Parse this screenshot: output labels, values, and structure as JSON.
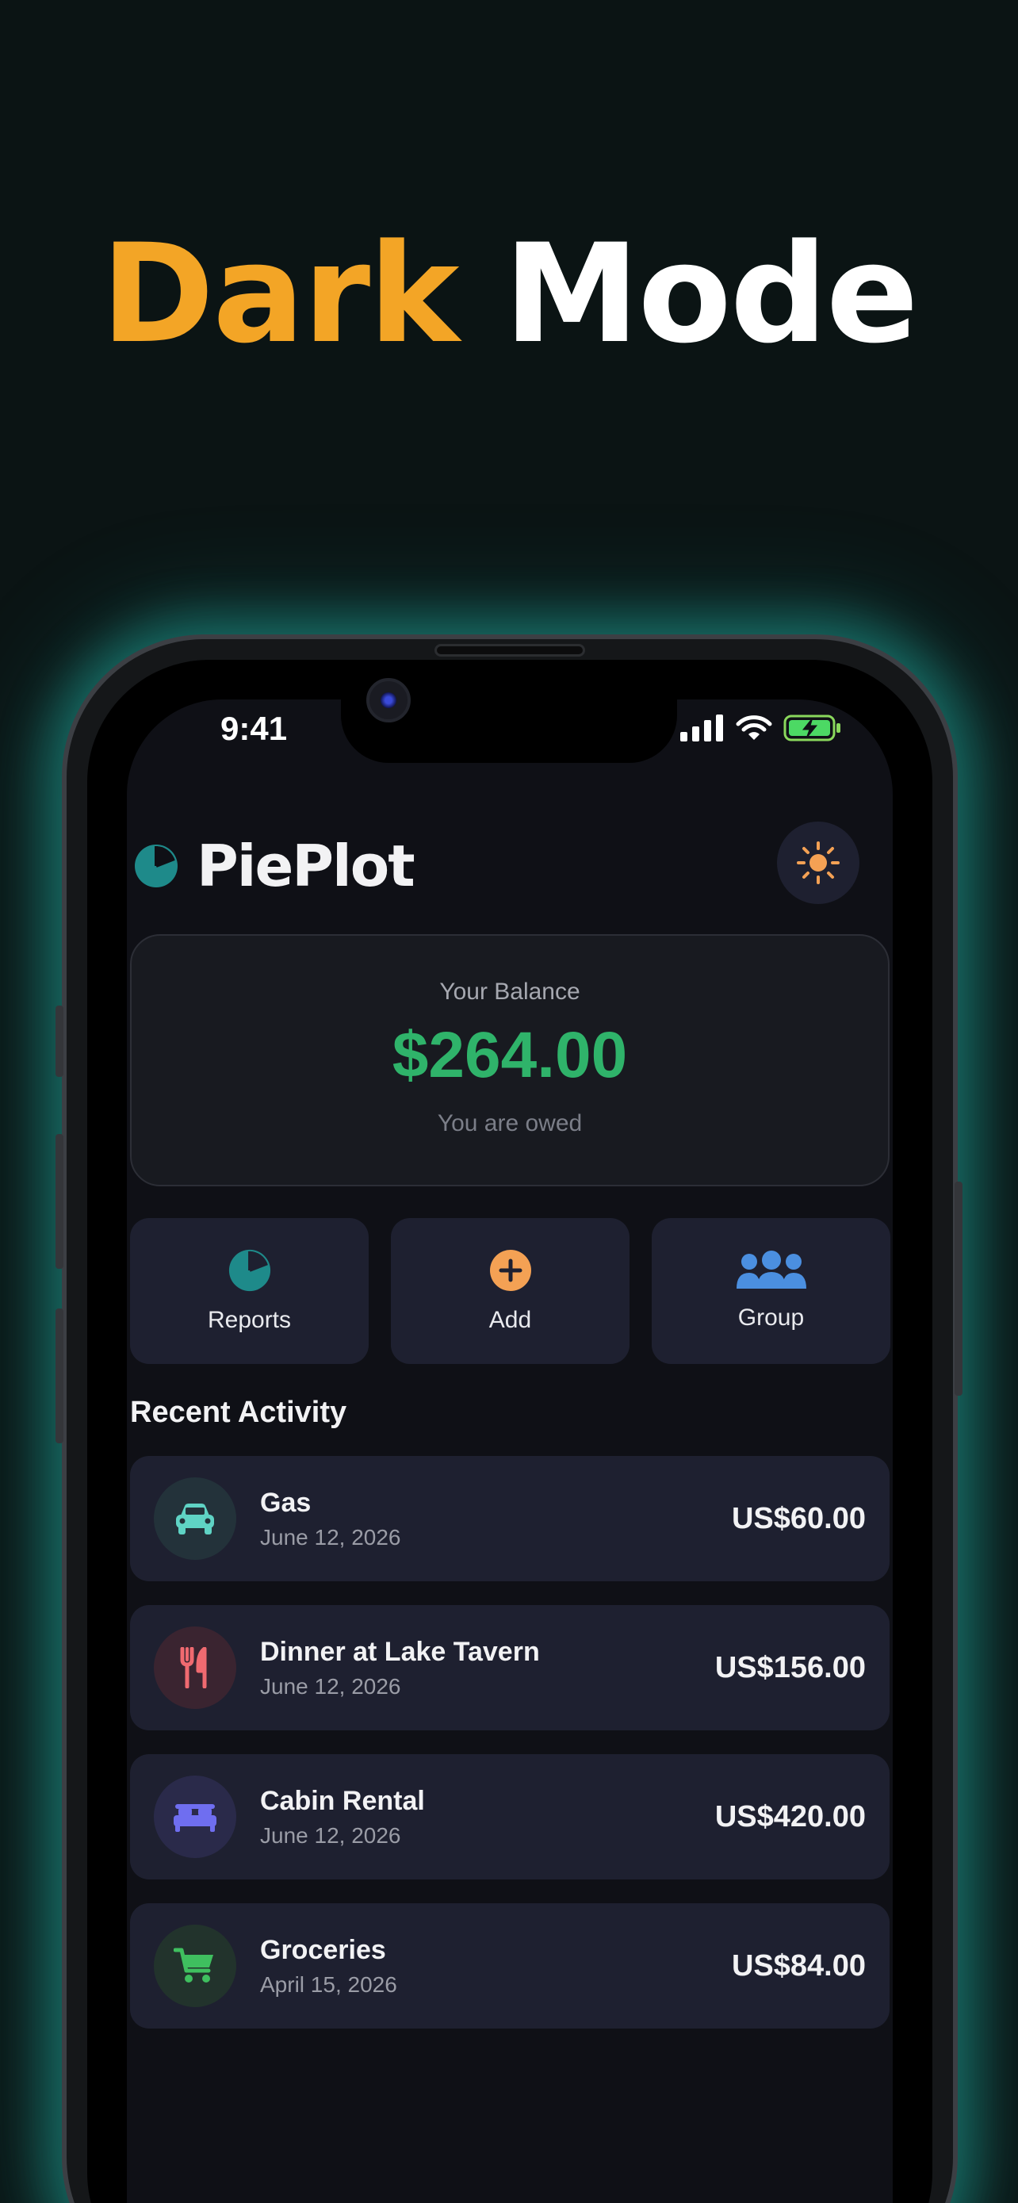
{
  "headline": {
    "word1": "Dark",
    "word2": "Mode"
  },
  "colors": {
    "accent_orange": "#f3a526",
    "teal": "#1e8a8a",
    "balance_green": "#2fb36a",
    "background": "#0b1414",
    "card": "#1e2030"
  },
  "status_bar": {
    "time": "9:41",
    "icons": [
      "signal-icon",
      "wifi-icon",
      "battery-charging-icon"
    ]
  },
  "app": {
    "title": "PiePlot",
    "logo_icon": "pie-chart-icon",
    "theme_toggle_icon": "sun-icon"
  },
  "balance": {
    "label": "Your Balance",
    "amount": "$264.00",
    "subtitle": "You are owed"
  },
  "actions": [
    {
      "label": "Reports",
      "icon": "pie-chart-icon"
    },
    {
      "label": "Add",
      "icon": "plus-circle-icon"
    },
    {
      "label": "Group",
      "icon": "users-icon"
    }
  ],
  "recent_activity": {
    "title": "Recent Activity",
    "items": [
      {
        "title": "Gas",
        "date": "June 12, 2026",
        "amount": "US$60.00",
        "icon": "car-icon"
      },
      {
        "title": "Dinner at Lake Tavern",
        "date": "June 12, 2026",
        "amount": "US$156.00",
        "icon": "utensils-icon"
      },
      {
        "title": "Cabin Rental",
        "date": "June 12, 2026",
        "amount": "US$420.00",
        "icon": "bed-icon"
      },
      {
        "title": "Groceries",
        "date": "April 15, 2026",
        "amount": "US$84.00",
        "icon": "cart-icon"
      }
    ]
  }
}
